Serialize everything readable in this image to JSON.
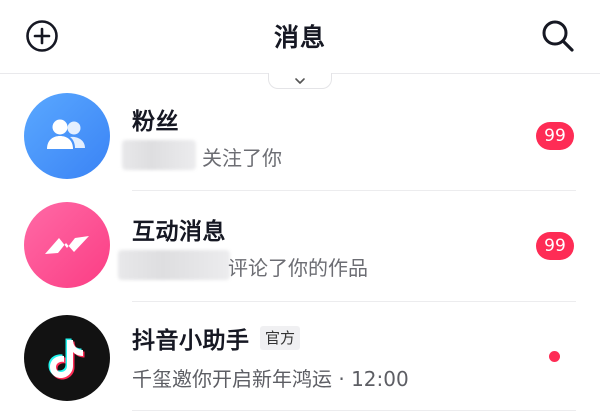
{
  "header": {
    "title": "消息",
    "left_icon": "add-circle-icon",
    "right_icon": "search-icon"
  },
  "colors": {
    "accent_red": "#fe2c55",
    "fans_blue": "#3a83f5",
    "interact_pink": "#fb3d84"
  },
  "messages": [
    {
      "title": "粉丝",
      "subtitle": "关注了你",
      "badge": "99",
      "icon": "fans-people-icon"
    },
    {
      "title": "互动消息",
      "subtitle": "评论了你的作品",
      "badge": "99",
      "icon": "lightning-chat-icon"
    },
    {
      "title": "抖音小助手",
      "tag": "官方",
      "subtitle": "千玺邀你开启新年鸿运 · 12:00",
      "icon": "tiktok-note-icon",
      "unread_dot": true
    }
  ]
}
